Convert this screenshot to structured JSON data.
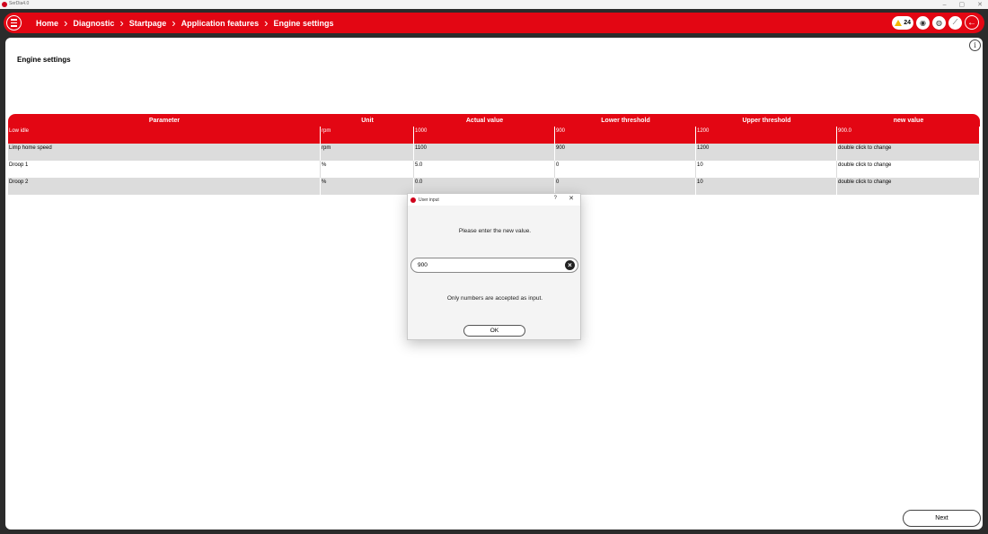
{
  "os": {
    "title": "SerDia4.0",
    "minimize": "–",
    "maximize": "▢",
    "close": "✕"
  },
  "breadcrumbs": [
    "Home",
    "Diagnostic",
    "Startpage",
    "Application features",
    "Engine settings"
  ],
  "header": {
    "warning_count": "24",
    "icons": [
      "warning-icon",
      "record-icon",
      "globe-icon",
      "link-icon",
      "back-arrow-icon"
    ]
  },
  "page": {
    "title": "Engine settings"
  },
  "table": {
    "columns": [
      "Parameter",
      "Unit",
      "Actual value",
      "Lower threshold",
      "Upper threshold",
      "new value"
    ],
    "rows": [
      [
        "Low idle",
        "rpm",
        "1000",
        "900",
        "1200",
        "900.0"
      ],
      [
        "Limp home speed",
        "rpm",
        "1100",
        "900",
        "1200",
        "double click to change"
      ],
      [
        "Droop 1",
        "%",
        "5.0",
        "0",
        "10",
        "double click to change"
      ],
      [
        "Droop 2",
        "%",
        "0.0",
        "0",
        "10",
        "double click to change"
      ]
    ]
  },
  "dialog": {
    "title": "User input",
    "help": "?",
    "close": "✕",
    "prompt": "Please enter the new value.",
    "input_value": "900",
    "note": "Only numbers are accepted as input.",
    "ok_label": "OK"
  },
  "footer": {
    "next_label": "Next"
  },
  "colors": {
    "brand_red": "#e30613",
    "row_alt": "#dcdcdc"
  }
}
